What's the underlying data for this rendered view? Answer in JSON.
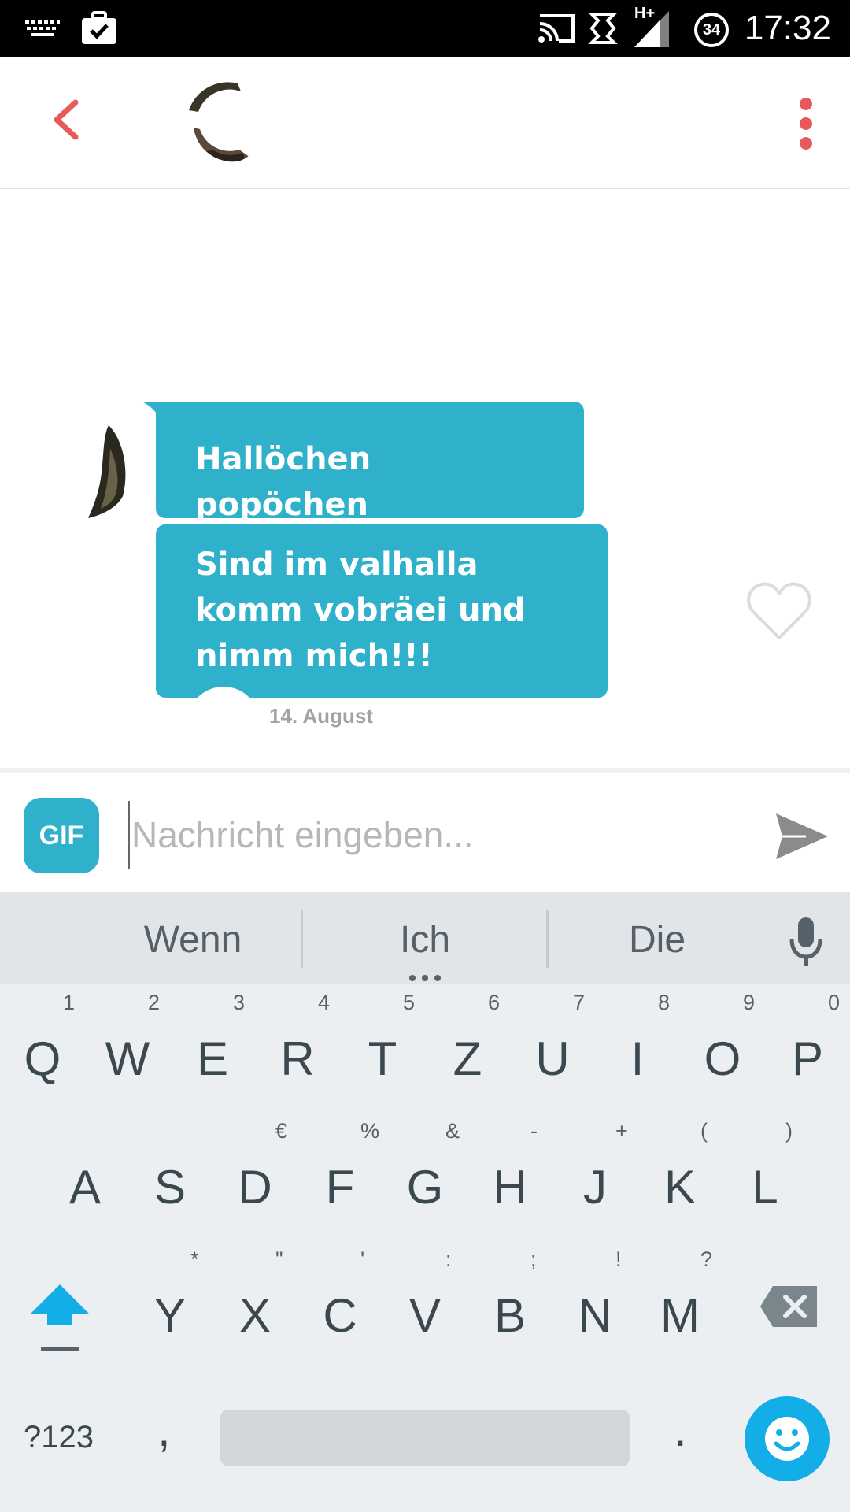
{
  "status_bar": {
    "time": "17:32",
    "battery_level": "34",
    "network": "H+",
    "icons": [
      "keyboard-icon",
      "briefcase-check-icon",
      "cast-icon",
      "rotation-icon",
      "signal-icon",
      "battery-icon"
    ]
  },
  "header": {
    "back_icon": "chevron-left-icon",
    "menu_icon": "more-vertical-icon",
    "accent_color": "#e85a5a"
  },
  "chat": {
    "messages": [
      {
        "text": "Hallöchen popöchen"
      },
      {
        "text": "Sind im valhalla komm vobräei und nimm mich!!!"
      }
    ],
    "date": "14. August",
    "bubble_color": "#2fb1cb"
  },
  "input": {
    "gif_label": "GIF",
    "placeholder": "Nachricht eingeben...",
    "send_icon": "send-icon"
  },
  "keyboard": {
    "suggestions": [
      "Wenn",
      "Ich",
      "Die"
    ],
    "row1": [
      {
        "key": "Q",
        "hint": "1"
      },
      {
        "key": "W",
        "hint": "2"
      },
      {
        "key": "E",
        "hint": "3"
      },
      {
        "key": "R",
        "hint": "4"
      },
      {
        "key": "T",
        "hint": "5"
      },
      {
        "key": "Z",
        "hint": "6"
      },
      {
        "key": "U",
        "hint": "7"
      },
      {
        "key": "I",
        "hint": "8"
      },
      {
        "key": "O",
        "hint": "9"
      },
      {
        "key": "P",
        "hint": "0"
      }
    ],
    "row2": [
      {
        "key": "A",
        "hint": ""
      },
      {
        "key": "S",
        "hint": ""
      },
      {
        "key": "D",
        "hint": "€"
      },
      {
        "key": "F",
        "hint": "%"
      },
      {
        "key": "G",
        "hint": "&"
      },
      {
        "key": "H",
        "hint": "-"
      },
      {
        "key": "J",
        "hint": "+"
      },
      {
        "key": "K",
        "hint": "("
      },
      {
        "key": "L",
        "hint": ")"
      }
    ],
    "row3": [
      {
        "key": "Y",
        "hint": "*"
      },
      {
        "key": "X",
        "hint": "\""
      },
      {
        "key": "C",
        "hint": "'"
      },
      {
        "key": "V",
        "hint": ":"
      },
      {
        "key": "B",
        "hint": ";"
      },
      {
        "key": "N",
        "hint": "!"
      },
      {
        "key": "M",
        "hint": "?"
      }
    ],
    "symbols_label": "?123",
    "comma": ",",
    "period": ".",
    "emoji_color": "#13ade8"
  }
}
